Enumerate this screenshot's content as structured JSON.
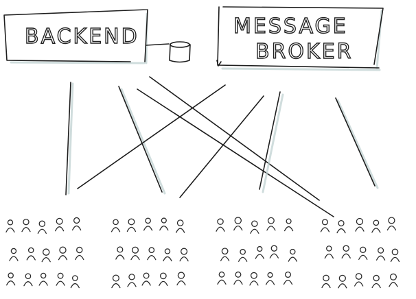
{
  "boxes": {
    "backend": {
      "label": "BACKEND"
    },
    "broker": {
      "line1": "MESSAGE",
      "line2": "BROKER"
    }
  },
  "crowd": {
    "groups": 4,
    "rows": 3,
    "cols": 5
  },
  "colors": {
    "ink": "#1e1e1e",
    "shadow": "#bccfcf",
    "background": "#ffffff"
  }
}
